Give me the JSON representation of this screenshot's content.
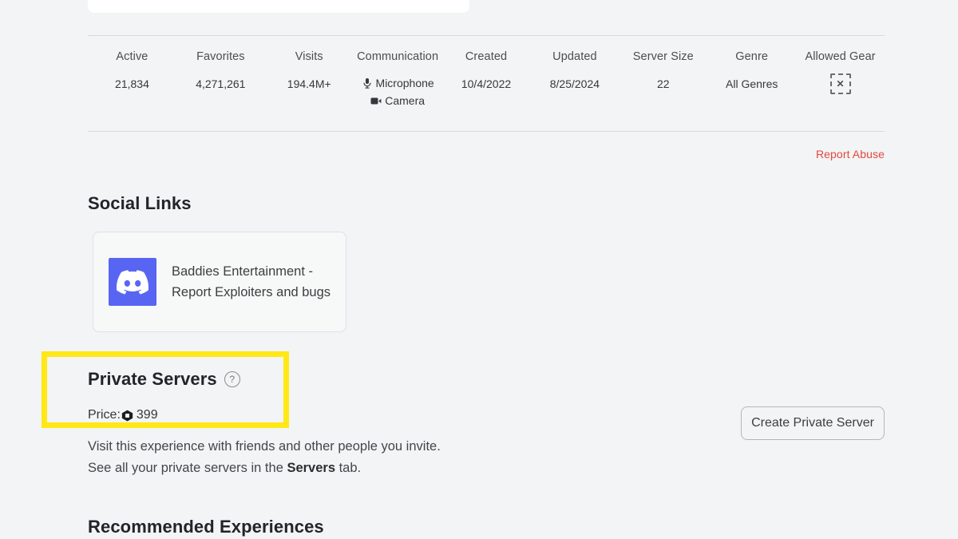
{
  "stats": {
    "columns": [
      {
        "label": "Active",
        "value": "21,834"
      },
      {
        "label": "Favorites",
        "value": "4,271,261"
      },
      {
        "label": "Visits",
        "value": "194.4M+"
      },
      {
        "label": "Communication",
        "value": ""
      },
      {
        "label": "Created",
        "value": "10/4/2022"
      },
      {
        "label": "Updated",
        "value": "8/25/2024"
      },
      {
        "label": "Server Size",
        "value": "22"
      },
      {
        "label": "Genre",
        "value": "All Genres"
      },
      {
        "label": "Allowed Gear",
        "value": ""
      }
    ],
    "communication": {
      "microphone": "Microphone",
      "camera": "Camera",
      "microphone_icon": "microphone-icon",
      "camera_icon": "camera-icon"
    },
    "allowed_gear": {
      "icon": "no-gear-icon",
      "glyph": "✕"
    }
  },
  "report_abuse": {
    "label": "Report Abuse",
    "color": "#e2483d"
  },
  "social_links": {
    "title": "Social Links",
    "cards": [
      {
        "platform": "discord",
        "icon": "discord-icon",
        "brand_color": "#5865f2",
        "text": "Baddies Entertainment - Report Exploiters and bugs"
      }
    ]
  },
  "private_servers": {
    "title": "Private Servers",
    "help_icon": "help-circle-icon",
    "help_glyph": "?",
    "price_label": "Price:",
    "price_value": "399",
    "currency_icon": "robux-icon",
    "description_line_1": "Visit this experience with friends and other people you invite.",
    "description_line_2_before": "See all your private servers in the ",
    "description_line_2_bold": "Servers",
    "description_line_2_after": " tab.",
    "create_button": "Create Private Server",
    "highlight_color": "#ffe815"
  },
  "recommended": {
    "title": "Recommended Experiences"
  }
}
